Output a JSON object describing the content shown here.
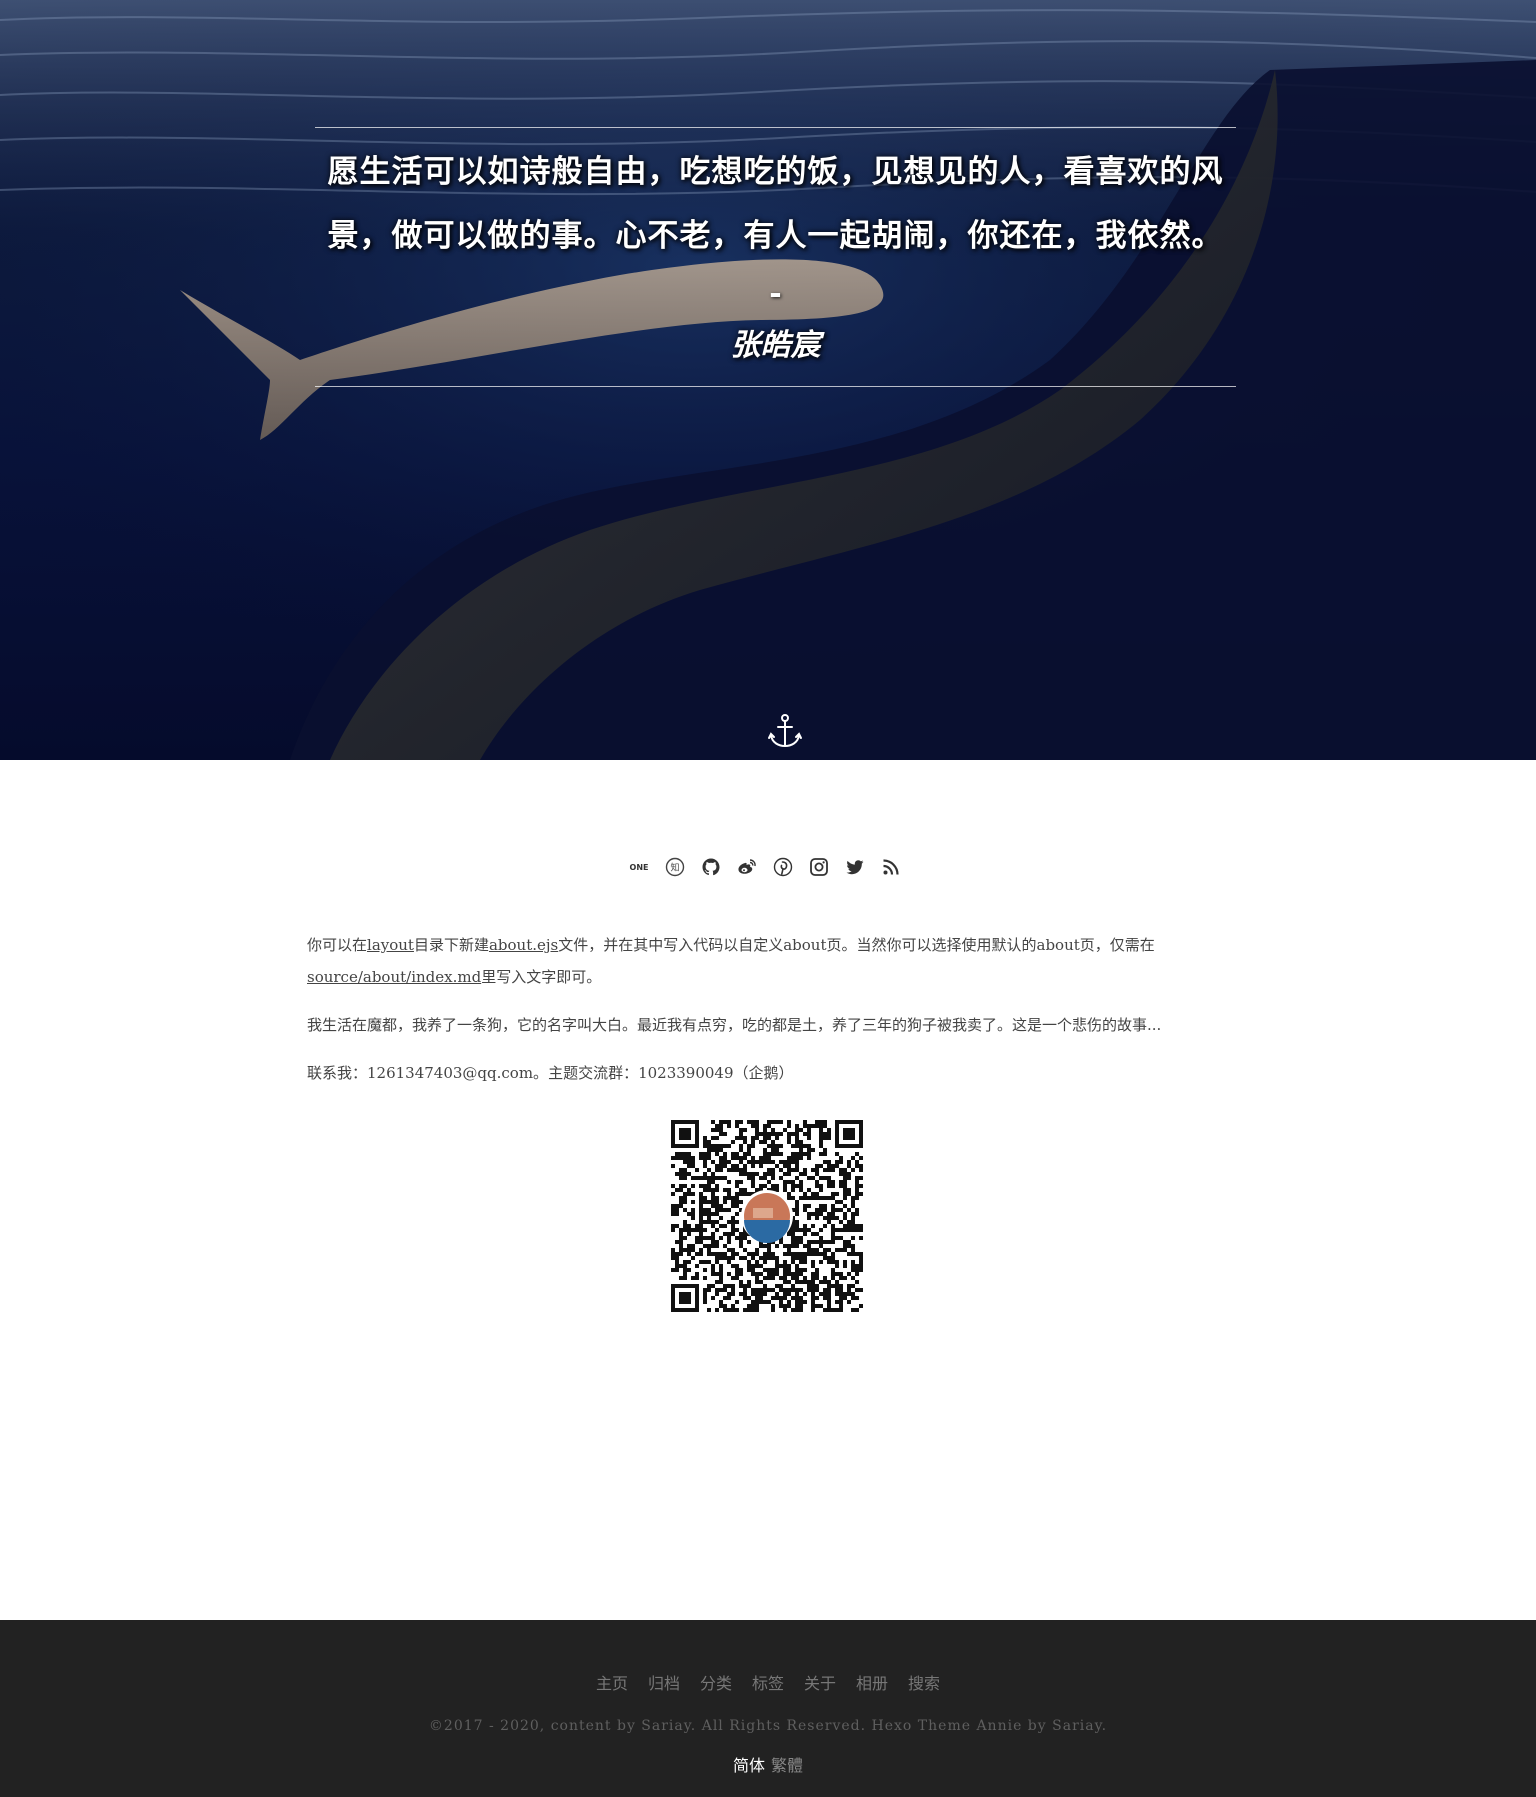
{
  "hero": {
    "quote": "愿生活可以如诗般自由，吃想吃的饭，见想见的人，看喜欢的风景，做可以做的事。心不老，有人一起胡闹，你还在，我依然。",
    "dash": "-",
    "author": "张皓宸",
    "scroll_icon": "anchor-icon"
  },
  "social": [
    {
      "name": "one",
      "icon": "one-icon"
    },
    {
      "name": "zhihu",
      "icon": "zhihu-icon"
    },
    {
      "name": "github",
      "icon": "github-icon"
    },
    {
      "name": "weibo",
      "icon": "weibo-icon"
    },
    {
      "name": "pinterest",
      "icon": "pinterest-icon"
    },
    {
      "name": "instagram",
      "icon": "instagram-icon"
    },
    {
      "name": "twitter",
      "icon": "twitter-icon"
    },
    {
      "name": "rss",
      "icon": "rss-icon"
    }
  ],
  "about": {
    "p1_a": "你可以在",
    "p1_link1": "layout",
    "p1_b": "目录下新建",
    "p1_link2": "about.ejs",
    "p1_c": "文件，并在其中写入代码以自定义about页。当然你可以选择使用默认的about页，仅需在",
    "p1_link3": "source/about/index.md",
    "p1_d": "里写入文字即可。",
    "p2": "我生活在魔都，我养了一条狗，它的名字叫大白。最近我有点穷，吃的都是土，养了三年的狗子被我卖了。这是一个悲伤的故事...",
    "p3": "联系我：1261347403@qq.com。主题交流群：1023390049（企鹅）"
  },
  "footer": {
    "nav": [
      "主页",
      "归档",
      "分类",
      "标签",
      "关于",
      "相册",
      "搜索"
    ],
    "copyright": "©2017 - 2020, content by Sariay. All Rights Reserved. Hexo Theme Annie by Sariay.",
    "lang_simplified": "简体",
    "lang_traditional": "繁體"
  },
  "colors": {
    "footer_bg": "#222222",
    "text": "#444444",
    "hero_bg": "#0b1640"
  }
}
